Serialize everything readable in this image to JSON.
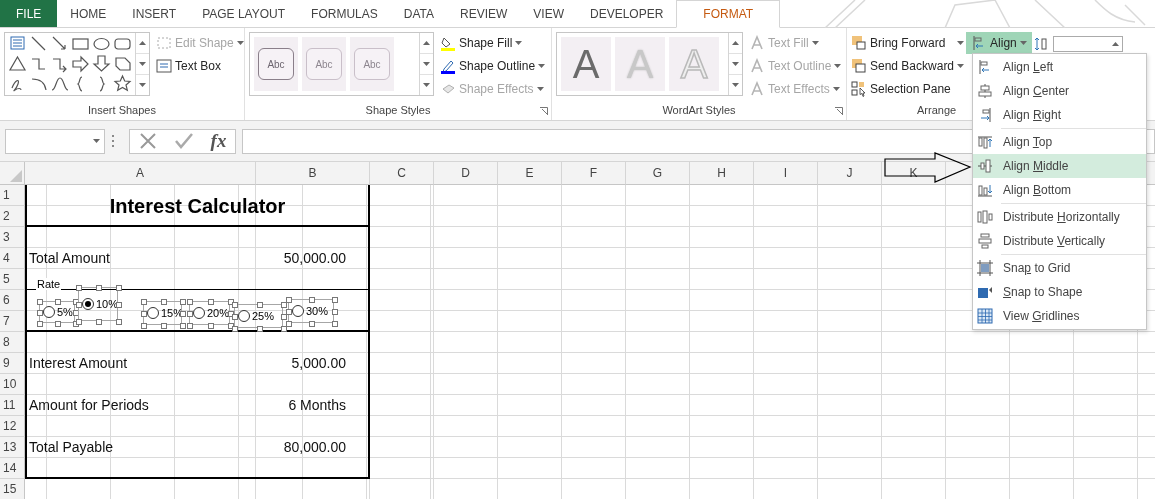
{
  "tabs": [
    {
      "label": "FILE",
      "kind": "file",
      "selected": false
    },
    {
      "label": "HOME",
      "kind": "tab",
      "selected": false
    },
    {
      "label": "INSERT",
      "kind": "tab",
      "selected": false
    },
    {
      "label": "PAGE LAYOUT",
      "kind": "tab",
      "selected": false
    },
    {
      "label": "FORMULAS",
      "kind": "tab",
      "selected": false
    },
    {
      "label": "DATA",
      "kind": "tab",
      "selected": false
    },
    {
      "label": "REVIEW",
      "kind": "tab",
      "selected": false
    },
    {
      "label": "VIEW",
      "kind": "tab",
      "selected": false
    },
    {
      "label": "DEVELOPER",
      "kind": "tab",
      "selected": false
    },
    {
      "label": "FORMAT",
      "kind": "tab",
      "selected": true
    }
  ],
  "ribbon": {
    "insert_shapes": {
      "label": "Insert Shapes",
      "commands": [
        {
          "label": "Edit Shape",
          "disabled": true
        },
        {
          "label": "Text Box",
          "disabled": false
        }
      ]
    },
    "shape_styles": {
      "label": "Shape Styles",
      "samples": [
        "Abc",
        "Abc",
        "Abc"
      ],
      "commands": [
        {
          "label": "Shape Fill",
          "disabled": false
        },
        {
          "label": "Shape Outline",
          "disabled": false
        },
        {
          "label": "Shape Effects",
          "disabled": true
        }
      ]
    },
    "wordart_styles": {
      "label": "WordArt Styles",
      "samples": [
        "A",
        "A",
        "A"
      ],
      "commands": [
        {
          "label": "Text Fill",
          "disabled": true
        },
        {
          "label": "Text Outline",
          "disabled": true
        },
        {
          "label": "Text Effects",
          "disabled": true
        }
      ]
    },
    "arrange": {
      "label": "Arrange",
      "commands": [
        {
          "label": "Bring Forward"
        },
        {
          "label": "Send Backward"
        },
        {
          "label": "Selection Pane"
        }
      ],
      "align": {
        "label": "Align",
        "expanded": true
      }
    }
  },
  "formula_bar": {
    "function_label": "fx"
  },
  "sheet": {
    "columns": [
      "A",
      "B",
      "C",
      "D",
      "E",
      "F",
      "G",
      "H",
      "I",
      "J",
      "K"
    ],
    "title": "Interest Calculator",
    "rows": [
      {
        "label": "1",
        "kind": "plain"
      },
      {
        "label": "2",
        "kind": "heavy_ruled"
      },
      {
        "label": "3",
        "kind": "plain"
      },
      {
        "label": "4",
        "kind": "plain",
        "a": "Total Amount",
        "b": "50,000.00"
      },
      {
        "label": "5",
        "kind": "ruled"
      },
      {
        "label": "6",
        "kind": "plain"
      },
      {
        "label": "7",
        "kind": "heavy_ruled"
      },
      {
        "label": "8",
        "kind": "plain"
      },
      {
        "label": "9",
        "kind": "plain",
        "a": "Interest Amount",
        "b": "5,000.00"
      },
      {
        "label": "10",
        "kind": "plain"
      },
      {
        "label": "11",
        "kind": "plain",
        "a": "Amount for Periods",
        "b": "6 Months"
      },
      {
        "label": "12",
        "kind": "plain"
      },
      {
        "label": "13",
        "kind": "plain",
        "a": "Total Payable",
        "b": "80,000.00"
      },
      {
        "label": "14",
        "kind": "heavy_ruled"
      },
      {
        "label": "15",
        "kind": "outside"
      }
    ],
    "rate_group": {
      "label": "Rate",
      "options": [
        {
          "label": "5%",
          "selected": false
        },
        {
          "label": "10%",
          "selected": true
        },
        {
          "label": "15%",
          "selected": false
        },
        {
          "label": "20%",
          "selected": false
        },
        {
          "label": "25%",
          "selected": false
        },
        {
          "label": "30%",
          "selected": false
        }
      ]
    }
  },
  "align_menu": {
    "groups": [
      [
        {
          "pre": "Align ",
          "key": "L",
          "post": "eft",
          "highlighted": false
        },
        {
          "pre": "Align ",
          "key": "C",
          "post": "enter",
          "highlighted": false
        },
        {
          "pre": "Align ",
          "key": "R",
          "post": "ight",
          "highlighted": false
        }
      ],
      [
        {
          "pre": "Align ",
          "key": "T",
          "post": "op",
          "highlighted": false
        },
        {
          "pre": "Align ",
          "key": "M",
          "post": "iddle",
          "highlighted": true
        },
        {
          "pre": "Align ",
          "key": "B",
          "post": "ottom",
          "highlighted": false
        }
      ],
      [
        {
          "pre": "Distribute ",
          "key": "H",
          "post": "orizontally",
          "highlighted": false
        },
        {
          "pre": "Distribute ",
          "key": "V",
          "post": "ertically",
          "highlighted": false
        }
      ],
      [
        {
          "pre": "Sna",
          "key": "p",
          "post": " to Grid",
          "highlighted": false
        },
        {
          "key": "S",
          "post": "nap to Shape",
          "highlighted": false
        },
        {
          "pre": "View ",
          "key": "G",
          "post": "ridlines",
          "highlighted": false
        }
      ]
    ]
  }
}
